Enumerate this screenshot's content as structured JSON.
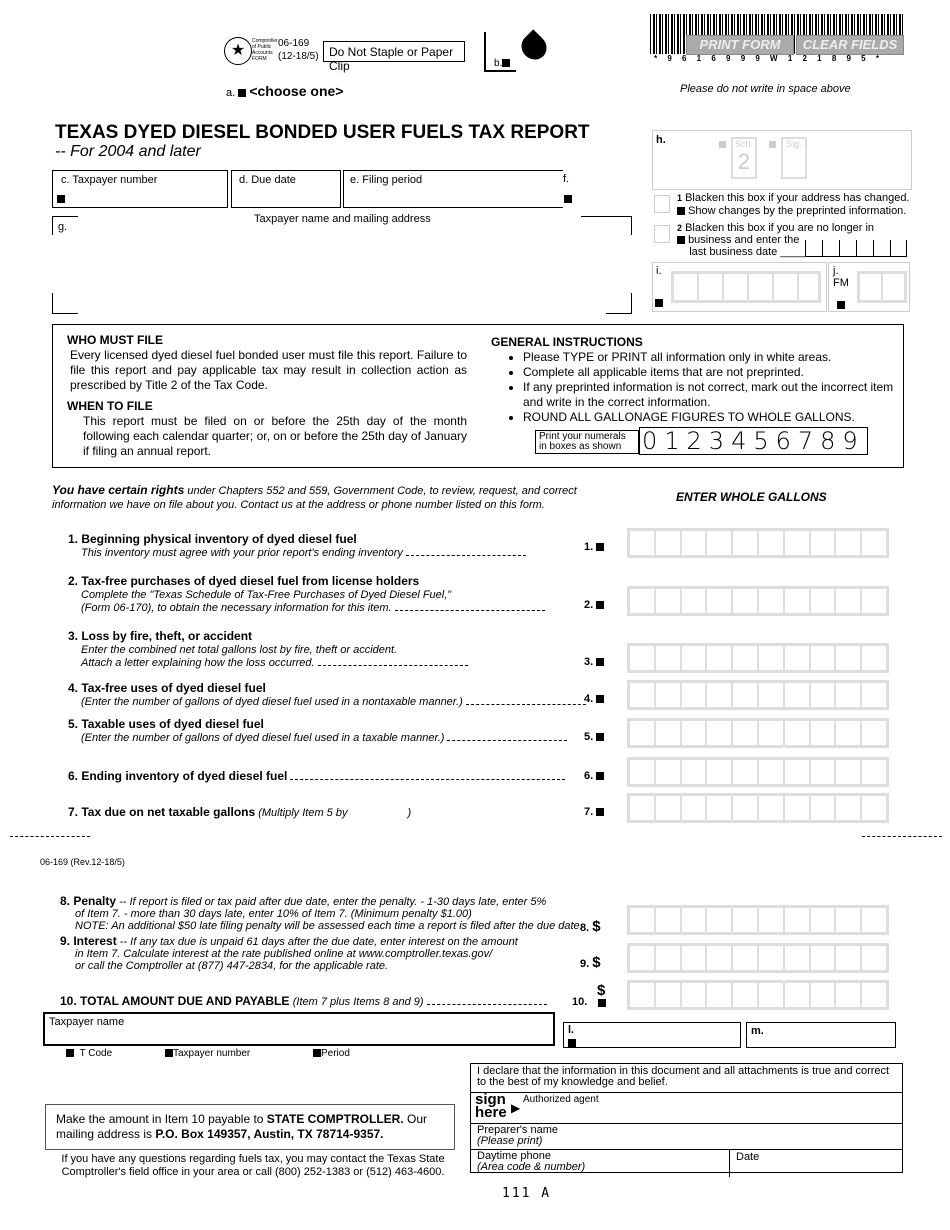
{
  "header": {
    "seal_text": "Comptroller of Public Accounts FORM",
    "form_number": "06-169",
    "form_revision": "(12-18/5)",
    "staple_notice": "Do Not Staple or Paper Clip",
    "b_label": "b.",
    "a_label": "a.",
    "choose_one": "<choose one>",
    "barcode_digits": "* 9 6 1 6 9 9 9 W 1 2 1 8 9 5 *",
    "print_button": "PRINT FORM",
    "clear_button": "CLEAR FIELDS",
    "no_write_notice": "Please do not write in space above"
  },
  "title": {
    "main": "TEXAS DYED DIESEL BONDED USER FUELS TAX REPORT",
    "sub": "-- For 2004 and later"
  },
  "fields": {
    "c": "c. Taxpayer number",
    "d": "d. Due date",
    "e": "e. Filing period",
    "f": "f.",
    "g": "g.",
    "name_address": "Taxpayer name and mailing address",
    "h": "h.",
    "sch": "Sch.",
    "sig": "Sig.",
    "sch_value": "2",
    "box1_num": "1",
    "box1_text": "Blacken this box if your address has changed.",
    "box1_text2": "Show changes by the preprinted information.",
    "box2_num": "2",
    "box2_text": "Blacken this box if you are no longer in",
    "box2_text2": "business and enter the",
    "box2_text3": "last business date ____",
    "i": "i.",
    "j": "j.",
    "fm": "FM"
  },
  "instructions": {
    "who_title": "WHO MUST FILE",
    "who_text": "Every licensed dyed diesel fuel bonded user must file this report. Failure to file this report and pay applicable tax may result in collection action as prescribed by Title 2 of the Tax Code.",
    "when_title": "WHEN TO FILE",
    "when_text": "This report must be filed on or before the 25th day of the month following each calendar quarter; or, on or before the 25th day of January if filing an annual report.",
    "general_title": "GENERAL INSTRUCTIONS",
    "general_items": [
      "Please TYPE or PRINT all information only in white areas.",
      "Complete all applicable items that are not preprinted.",
      "If any preprinted information is not correct, mark out the incorrect item and write in the correct information.",
      "ROUND ALL GALLONAGE FIGURES TO WHOLE GALLONS."
    ],
    "numerals_label": "Print your numerals in boxes as shown",
    "numerals": "0123456789"
  },
  "rights": {
    "bold": "You have certain rights",
    "text": "under Chapters 552 and 559, Government Code, to review, request, and correct information we have on file about you.  Contact us at the address or phone number listed on this form."
  },
  "enter_whole_gallons": "ENTER WHOLE GALLONS",
  "items": [
    {
      "title": "1. Beginning physical inventory of dyed diesel fuel",
      "note": "This inventory must agree with your prior report's ending inventory",
      "num": "1."
    },
    {
      "title": "2. Tax-free purchases of dyed diesel fuel from license holders",
      "note": "Complete the \"Texas Schedule of Tax-Free Purchases of Dyed Diesel Fuel,\"",
      "note2": "(Form 06-170), to obtain the necessary information for this item.",
      "num": "2."
    },
    {
      "title": "3. Loss by fire, theft, or accident",
      "note": "Enter the combined net total gallons lost by fire, theft or  accident.",
      "note2": "Attach a letter explaining how the loss occurred.",
      "num": "3."
    },
    {
      "title": "4. Tax-free uses of dyed diesel fuel",
      "note": "(Enter the number of gallons of dyed diesel fuel used in a nontaxable manner.)",
      "num": "4."
    },
    {
      "title": "5. Taxable uses of dyed diesel fuel",
      "note": "(Enter the number of gallons of dyed diesel fuel used in a taxable manner.)",
      "num": "5."
    },
    {
      "title": "6. Ending inventory of dyed diesel fuel",
      "num": "6."
    },
    {
      "title": "7. Tax due on net taxable gallons",
      "note": "(Multiply Item 5 by",
      "note2": ")",
      "num": "7."
    }
  ],
  "rev": "06-169 (Rev.12-18/5)",
  "item8": {
    "title": "8. Penalty",
    "l1": "-- If report is filed or tax paid after due date, enter the penalty. - 1-30 days late, enter 5%",
    "l2": "of Item 7.  - more than 30 days late, enter 10% of Item 7. (Minimum penalty  $1.00)",
    "l3": "NOTE: An additional $50 late filing penalty will be assessed each time a report is filed after the due date.",
    "num": "8.",
    "cur": "$"
  },
  "item9": {
    "title": "9. Interest",
    "l1": "-- If any tax due is unpaid 61 days after the due date, enter interest on the amount",
    "l2": "in Item 7. Calculate interest at the rate published online at www.comptroller.texas.gov/",
    "l3": "or call the Comptroller at (877) 447-2834, for the applicable rate.",
    "num": "9.",
    "cur": "$"
  },
  "item10": {
    "title": "10. TOTAL AMOUNT DUE AND PAYABLE",
    "note": "(Item 7 plus Items 8 and 9)",
    "num": "10.",
    "cur": "$"
  },
  "footer": {
    "taxpayer_name": "Taxpayer name",
    "l": "l.",
    "m": "m.",
    "tcode": "T Code",
    "taxpayer_number": "Taxpayer number",
    "period": "Period",
    "declare": "I declare that the information in this document and all attachments is true and correct to the best of my knowledge and belief.",
    "sign": "sign",
    "here": "here",
    "agent": "Authorized agent",
    "preparer": "Preparer's name",
    "please_print": "(Please print)",
    "phone": "Daytime phone",
    "phone_note": "(Area code & number)",
    "date": "Date",
    "pay1": "Make the amount in Item 10 payable to ",
    "pay_bold1": "STATE COMPTROLLER.",
    "pay2": " Our mailing address is ",
    "pay_bold2": "P.O. Box 149357, Austin, TX  78714-9357.",
    "questions": "If you have any questions regarding fuels tax, you may contact the Texas State Comptroller's field office in your area or call (800) 252-1383 or (512) 463-4600.",
    "code": "111 A"
  }
}
